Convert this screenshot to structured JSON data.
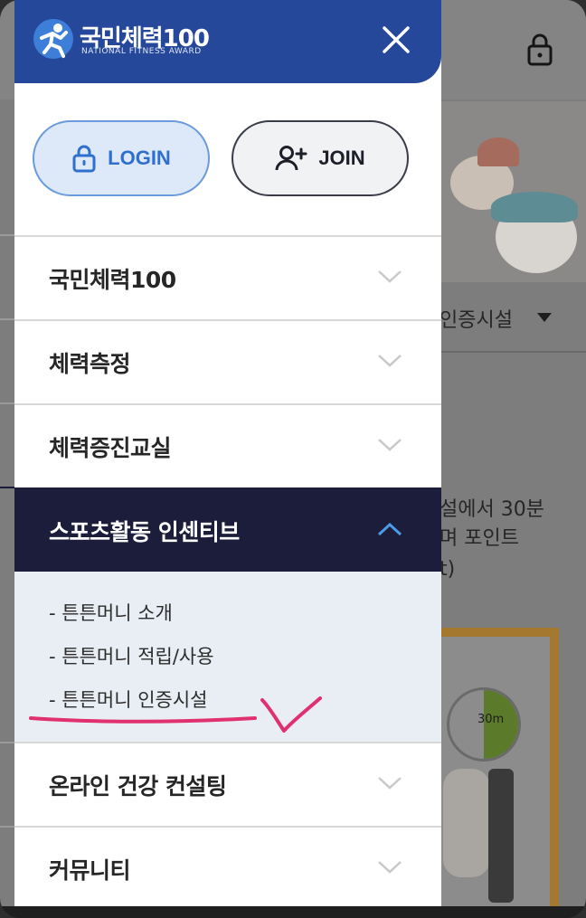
{
  "app": {
    "logo_title": "국민체력100",
    "logo_subtitle": "NATIONAL FITNESS AWARD"
  },
  "auth": {
    "login_label": "LOGIN",
    "join_label": "JOIN"
  },
  "menu": {
    "items": [
      {
        "label": "국민체력100"
      },
      {
        "label": "체력측정"
      },
      {
        "label": "체력증진교실"
      },
      {
        "label": "스포츠활동 인센티브"
      },
      {
        "label": "온라인 건강 컨설팅"
      },
      {
        "label": "커뮤니티"
      }
    ],
    "submenu": [
      {
        "label": "- 튼튼머니 소개"
      },
      {
        "label": "- 튼튼머니 적립/사용"
      },
      {
        "label": "- 튼튼머니 인증시설"
      }
    ]
  },
  "background": {
    "select_value": "인증시설",
    "text_line1": "설에서 30분",
    "text_line2": "며 포인트",
    "text_line3": "t)",
    "timer_label": "30m"
  },
  "colors": {
    "header_blue": "#26489a",
    "active_navy": "#1b1d3a",
    "login_blue": "#2f6fcf",
    "annotation_pink": "#e0306f"
  }
}
